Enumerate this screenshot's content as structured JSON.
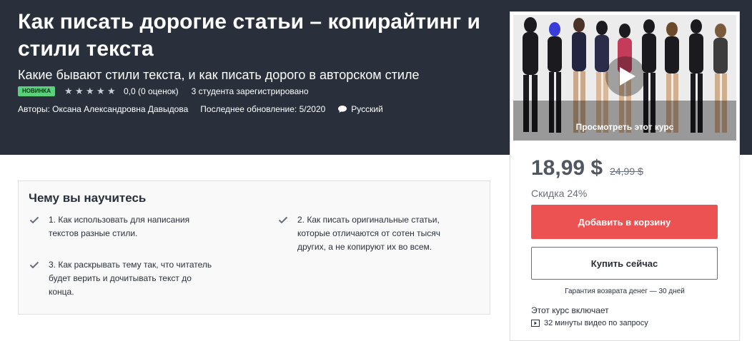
{
  "course": {
    "title": "Как писать дорогие статьи – копирайтинг и стили текста",
    "subtitle": "Какие бывают стили текста, и как писать дорого в авторском стиле",
    "badge": "НОВИНКА",
    "rating_value": 0,
    "rating_text": "0,0 (0 оценок)",
    "students": "3 студента зарегистрировано",
    "authors": "Авторы: Оксана Александровна Давыдова",
    "last_update": "Последнее обновление: 5/2020",
    "language": "Русский"
  },
  "icons": {
    "stars": "star-icon",
    "language": "speech-bubble-icon",
    "play": "play-icon",
    "check": "checkmark-icon",
    "video": "video-icon"
  },
  "sidebar": {
    "preview_label": "Просмотреть этот курс",
    "price": "18,99 $",
    "old_price": "24,99 $",
    "discount": "Скидка 24%",
    "add_to_cart": "Добавить в корзину",
    "buy_now": "Купить сейчас",
    "guarantee": "Гарантия возврата денег — 30 дней",
    "includes_title": "Этот курс включает",
    "includes": [
      "32 минуты видео по запросу"
    ]
  },
  "learn": {
    "title": "Чему вы научитесь",
    "items": [
      "1. Как использовать для написания текстов разные стили.",
      "2. Как писать оригинальные статьи, которые отличаются от сотен тысяч других, а не копируют их во всем.",
      "3. Как раскрывать тему так, что читатель будет верить и дочитывать текст до конца."
    ]
  },
  "colors": {
    "hero_bg": "#29303b",
    "badge_bg": "#5bd07a",
    "cart_button": "#ec5252",
    "text_dark": "#29303b",
    "muted": "#686f7a"
  }
}
